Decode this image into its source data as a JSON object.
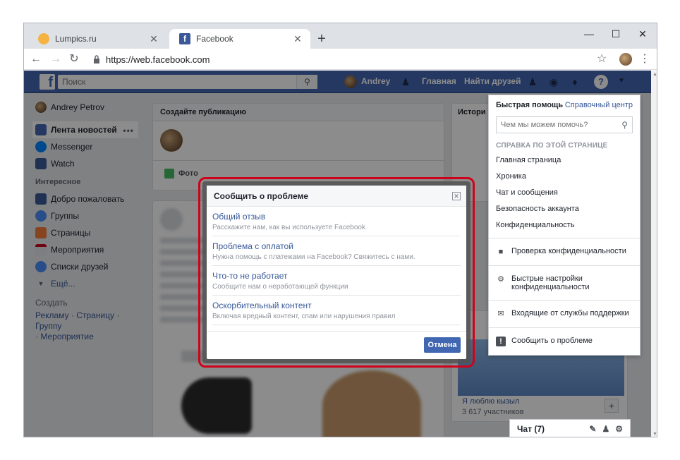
{
  "browser": {
    "tabs": [
      {
        "title": "Lumpics.ru",
        "active": false
      },
      {
        "title": "Facebook",
        "active": true
      }
    ],
    "new_tab": "+",
    "url": "https://web.facebook.com",
    "window_controls": {
      "minimize": "—",
      "maximize": "☐",
      "close": "✕"
    }
  },
  "fb": {
    "search_placeholder": "Поиск",
    "user_name": "Andrey",
    "nav": {
      "home": "Главная",
      "find_friends": "Найти друзей"
    }
  },
  "sidebar": {
    "profile": "Andrey Petrov",
    "items": [
      {
        "label": "Лента новостей",
        "active": true
      },
      {
        "label": "Messenger"
      },
      {
        "label": "Watch"
      }
    ],
    "interesting_title": "Интересное",
    "interesting": [
      {
        "label": "Добро пожаловать"
      },
      {
        "label": "Группы"
      },
      {
        "label": "Страницы"
      },
      {
        "label": "Мероприятия"
      },
      {
        "label": "Списки друзей"
      }
    ],
    "more": "Ещё...",
    "create_title": "Создать",
    "create_links": [
      "Рекламу",
      "Страницу",
      "Группу",
      "Мероприятие"
    ]
  },
  "feed": {
    "create_post_title": "Создайте публикацию",
    "photo_label": "Фото"
  },
  "right_col": {
    "stories_title": "Истори",
    "group_name": "Я люблю кызыл",
    "group_members": "3 617 участников"
  },
  "quick_help": {
    "title": "Быстрая помощь",
    "help_center": "Справочный центр",
    "search_placeholder": "Чем мы можем помочь?",
    "section_title": "СПРАВКА ПО ЭТОЙ СТРАНИЦЕ",
    "links": [
      "Главная страница",
      "Хроника",
      "Чат и сообщения",
      "Безопасность аккаунта",
      "Конфиденциальность"
    ],
    "actions": [
      {
        "label": "Проверка конфиденциальности",
        "icon": "lock-icon"
      },
      {
        "label": "Быстрые настройки конфиденциальности",
        "icon": "gear-icon"
      },
      {
        "label": "Входящие от службы поддержки",
        "icon": "envelope-icon"
      },
      {
        "label": "Сообщить о проблеме",
        "icon": "alert-icon"
      }
    ]
  },
  "modal": {
    "title": "Сообщить о проблеме",
    "items": [
      {
        "title": "Общий отзыв",
        "desc": "Расскажите нам, как вы используете Facebook"
      },
      {
        "title": "Проблема с оплатой",
        "desc": "Нужна помощь с платежами на Facebook? Свяжитесь с нами."
      },
      {
        "title": "Что-то не работает",
        "desc": "Сообщите нам о неработающей функции"
      },
      {
        "title": "Оскорбительный контент",
        "desc": "Включая вредный контент, спам или нарушения правил"
      }
    ],
    "cancel": "Отмена"
  },
  "chat": {
    "label": "Чат (7)"
  },
  "colors": {
    "fb_blue": "#4267b2",
    "highlight_red": "#d0021b"
  }
}
